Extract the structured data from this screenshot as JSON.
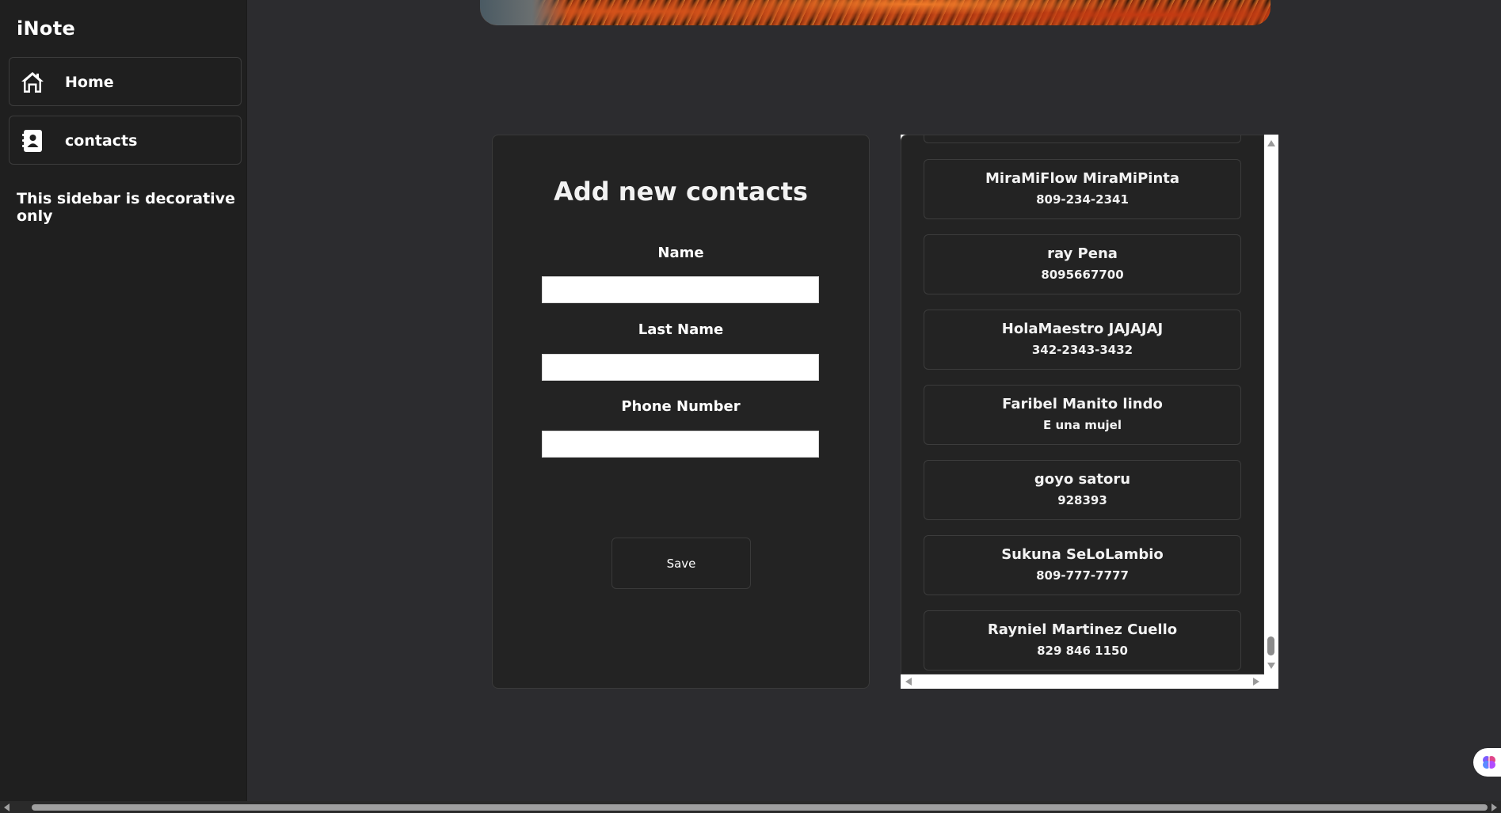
{
  "app": {
    "brand": "iNote"
  },
  "sidebar": {
    "items": [
      {
        "label": "Home",
        "icon": "home-icon"
      },
      {
        "label": "contacts",
        "icon": "contact-book-icon"
      }
    ],
    "note": "This sidebar is decorative only"
  },
  "form": {
    "title": "Add new contacts",
    "fields": [
      {
        "label": "Name",
        "value": ""
      },
      {
        "label": "Last Name",
        "value": ""
      },
      {
        "label": "Phone Number",
        "value": ""
      }
    ],
    "save_label": "Save"
  },
  "contacts": [
    {
      "name": "MiraMiFlow MiraMiPinta",
      "phone": "809-234-2341"
    },
    {
      "name": "ray Pena",
      "phone": "8095667700"
    },
    {
      "name": "HolaMaestro JAJAJAJ",
      "phone": "342-2343-3432"
    },
    {
      "name": "Faribel Manito lindo",
      "phone": "E una mujel"
    },
    {
      "name": "goyo satoru",
      "phone": "928393"
    },
    {
      "name": "Sukuna SeLoLambio",
      "phone": "809-777-7777"
    },
    {
      "name": "Rayniel Martinez Cuello",
      "phone": "829 846 1150"
    }
  ],
  "colors": {
    "page_background": "#2c2c2f",
    "sidebar_background": "#1f1f1f",
    "card_background": "#232323",
    "assistant_icon": "#7a5cff"
  }
}
